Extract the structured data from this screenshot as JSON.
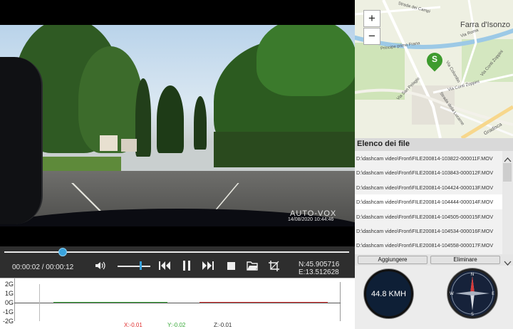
{
  "video": {
    "brand": "AUTO-VOX",
    "timestamp": "14/08/2020 10:44:46"
  },
  "player": {
    "time_display": "00:00:02 / 00:00:12",
    "seek_progress": 0.17,
    "volume_level": 0.7,
    "latitude": "N:45.905716",
    "longitude": "E:13.512628"
  },
  "gsensor": {
    "ticks": [
      "2G",
      "1G",
      "0G",
      "-1G",
      "-2G"
    ],
    "x_readout": "X:-0.01",
    "y_readout": "Y:-0.02",
    "z_readout": "Z:-0.01",
    "colors": {
      "x": "#e03030",
      "y": "#3aaa3a",
      "z": "#333333"
    }
  },
  "map": {
    "zoom_in": "+",
    "zoom_out": "−",
    "town": "Farra d'Isonzo",
    "marker_letter": "S",
    "marker_color": "#3e9b2e",
    "labels": [
      "Strada dei Campi",
      "Via Roma",
      "Principe primo Frana",
      "Via Colombo",
      "Via Conti Zoppini",
      "Via Conti Zoppini",
      "Via San Pelagio",
      "Strada della Lucarne",
      "Gradisca"
    ]
  },
  "files": {
    "title": "Elenco dei file",
    "items": [
      "D:\\dashcam video\\Front\\FILE200814-103822-000011F.MOV",
      "D:\\dashcam video\\Front\\FILE200814-103843-000012F.MOV",
      "D:\\dashcam video\\Front\\FILE200814-104424-000013F.MOV",
      "D:\\dashcam video\\Front\\FILE200814-104444-000014F.MOV",
      "D:\\dashcam video\\Front\\FILE200814-104505-000015F.MOV",
      "D:\\dashcam video\\Front\\FILE200814-104534-000016F.MOV",
      "D:\\dashcam video\\Front\\FILE200814-104558-000017F.MOV"
    ],
    "selected_index": 3,
    "add_label": "Aggiungere",
    "remove_label": "Eliminare"
  },
  "gauges": {
    "speed": "44.8 KMH",
    "compass_marks": [
      "N",
      "E",
      "S",
      "W"
    ]
  }
}
